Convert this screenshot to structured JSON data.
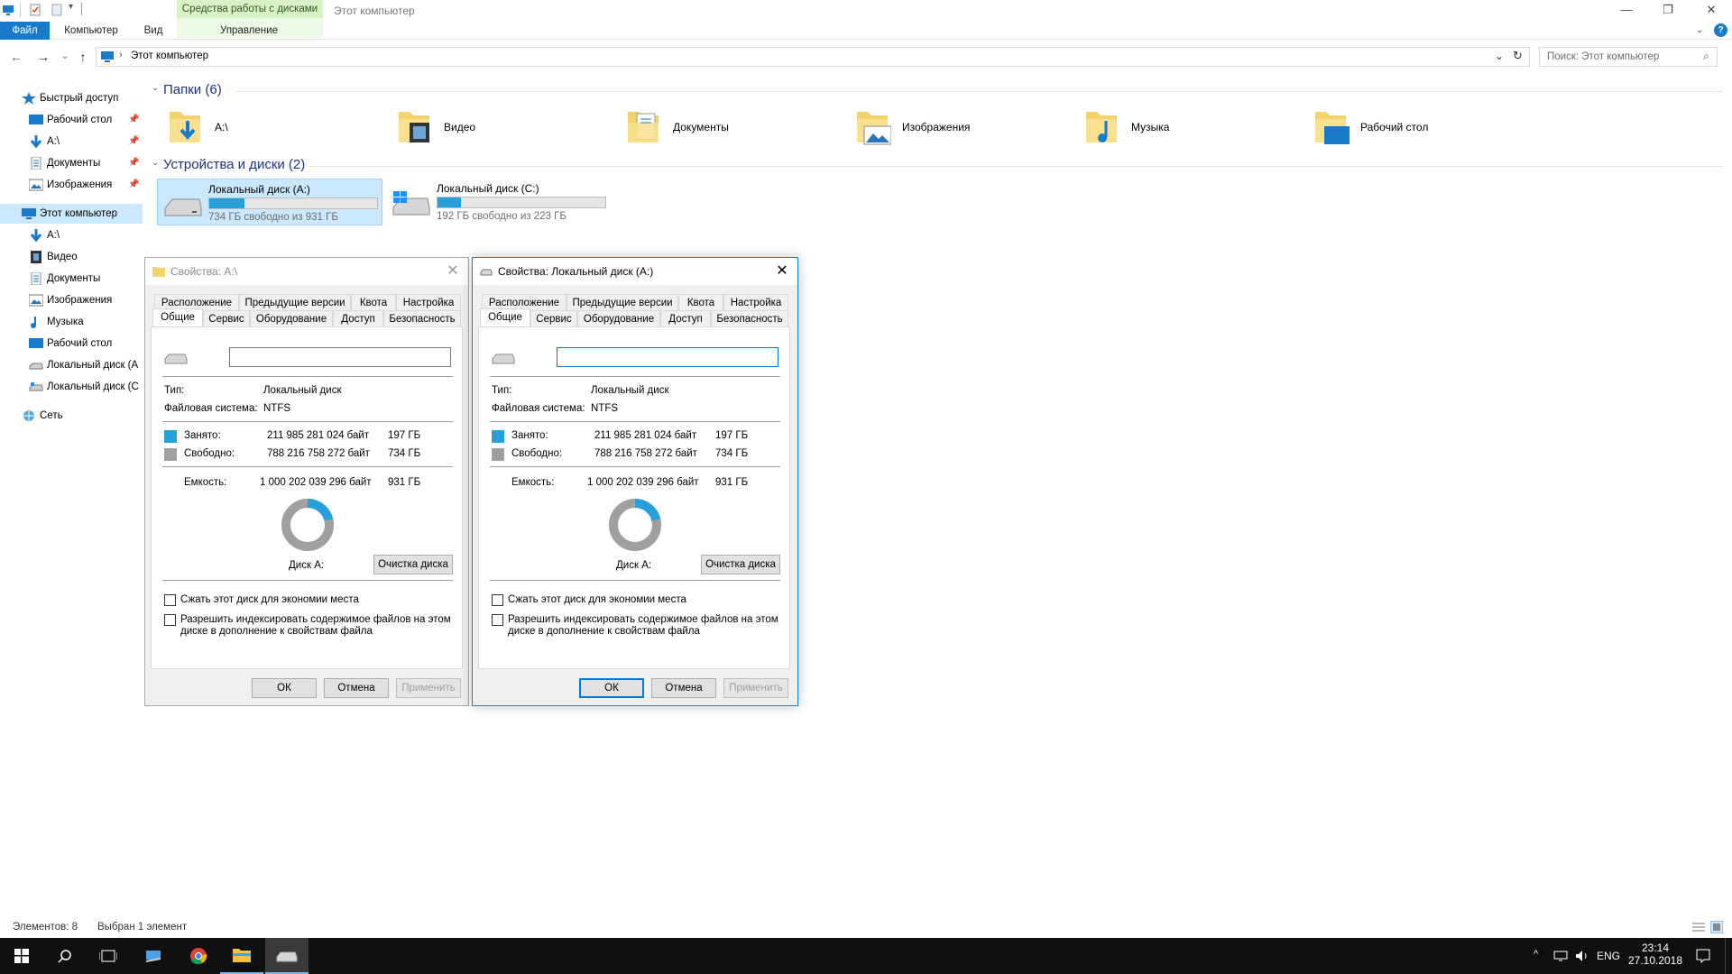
{
  "titlebar": {
    "context_tab": "Средства работы с дисками",
    "window_title": "Этот компьютер",
    "controls": {
      "minimize": "—",
      "restore": "❐",
      "close": "✕"
    }
  },
  "ribbon": {
    "tabs": [
      "Файл",
      "Компьютер",
      "Вид",
      "Управление"
    ],
    "help": "?"
  },
  "address": {
    "path": "Этот компьютер",
    "search_placeholder": "Поиск: Этот компьютер"
  },
  "nav": {
    "items": [
      {
        "label": "Быстрый доступ",
        "icon": "star-icon"
      },
      {
        "label": "Рабочий стол",
        "icon": "desktop-icon",
        "pinned": true
      },
      {
        "label": "A:\\",
        "icon": "download-arrow-icon",
        "pinned": true
      },
      {
        "label": "Документы",
        "icon": "documents-icon",
        "pinned": true
      },
      {
        "label": "Изображения",
        "icon": "pictures-icon",
        "pinned": true
      },
      {
        "label": "Этот компьютер",
        "icon": "computer-icon",
        "selected": true
      },
      {
        "label": "A:\\",
        "icon": "download-arrow-icon"
      },
      {
        "label": "Видео",
        "icon": "video-icon"
      },
      {
        "label": "Документы",
        "icon": "documents-icon"
      },
      {
        "label": "Изображения",
        "icon": "pictures-icon"
      },
      {
        "label": "Музыка",
        "icon": "music-icon"
      },
      {
        "label": "Рабочий стол",
        "icon": "desktop-icon"
      },
      {
        "label": "Локальный диск (A",
        "icon": "drive-icon"
      },
      {
        "label": "Локальный диск (C",
        "icon": "drive-icon"
      },
      {
        "label": "Сеть",
        "icon": "network-icon"
      }
    ]
  },
  "main": {
    "folders_header": "Папки (6)",
    "folders": [
      {
        "label": "A:\\",
        "icon": "download-folder-icon"
      },
      {
        "label": "Видео",
        "icon": "video-folder-icon"
      },
      {
        "label": "Документы",
        "icon": "documents-folder-icon"
      },
      {
        "label": "Изображения",
        "icon": "pictures-folder-icon"
      },
      {
        "label": "Музыка",
        "icon": "music-folder-icon"
      },
      {
        "label": "Рабочий стол",
        "icon": "desktop-folder-icon"
      }
    ],
    "devices_header": "Устройства и диски (2)",
    "drives": [
      {
        "name": "Локальный диск (A:)",
        "free": "734 ГБ свободно из 931 ГБ",
        "used_fraction": 0.21,
        "selected": true
      },
      {
        "name": "Локальный диск (C:)",
        "free": "192 ГБ свободно из 223 ГБ",
        "used_fraction": 0.14,
        "selected": false
      }
    ]
  },
  "status": {
    "count": "Элементов: 8",
    "selected": "Выбран 1 элемент"
  },
  "dialog_a": {
    "title": "Свойства: A:\\",
    "tabs_row1": [
      "Расположение",
      "Предыдущие версии",
      "Квота",
      "Настройка"
    ],
    "tabs_row2": [
      "Общие",
      "Сервис",
      "Оборудование",
      "Доступ",
      "Безопасность"
    ]
  },
  "dialog_b": {
    "title": "Свойства: Локальный диск (A:)",
    "tabs_row1": [
      "Расположение",
      "Предыдущие версии",
      "Квота",
      "Настройка"
    ],
    "tabs_row2": [
      "Общие",
      "Сервис",
      "Оборудование",
      "Доступ",
      "Безопасность"
    ]
  },
  "props": {
    "type_label": "Тип:",
    "type_value": "Локальный диск",
    "fs_label": "Файловая система:",
    "fs_value": "NTFS",
    "used_label": "Занято:",
    "used_bytes": "211 985 281 024 байт",
    "used_gb": "197 ГБ",
    "free_label": "Свободно:",
    "free_bytes": "788 216 758 272 байт",
    "free_gb": "734 ГБ",
    "cap_label": "Емкость:",
    "cap_bytes": "1 000 202 039 296 байт",
    "cap_gb": "931 ГБ",
    "disk_label": "Диск A:",
    "cleanup": "Очистка диска",
    "compress": "Сжать этот диск для экономии места",
    "index_line1": "Разрешить индексировать содержимое файлов на этом",
    "index_line2": "диске в дополнение к свойствам файла",
    "ok": "ОК",
    "cancel": "Отмена",
    "apply": "Применить",
    "used_fraction": 0.212,
    "used_color": "#26a0da",
    "free_color": "#a0a0a0"
  },
  "taskbar": {
    "tray": {
      "lang": "ENG",
      "time": "23:14",
      "date": "27.10.2018"
    }
  },
  "colors": {
    "accent": "#1979ca",
    "selection": "#cce8ff",
    "context_tab": "#d8f1c7"
  }
}
